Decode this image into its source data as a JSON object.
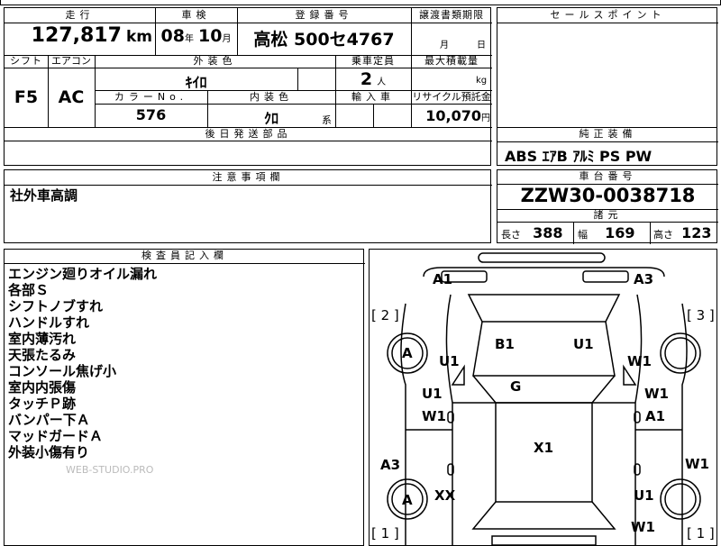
{
  "mileage": {
    "header": "走行",
    "value": "127,817",
    "unit": "km"
  },
  "inspection": {
    "header": "車検",
    "year": "08",
    "year_unit": "年",
    "month": "10",
    "month_unit": "月"
  },
  "registration": {
    "header": "登録番号",
    "value": "高松 500セ4767"
  },
  "transfer": {
    "header": "譲渡書類期限",
    "month_unit": "月",
    "day_unit": "日"
  },
  "sales_point": {
    "header": "セールスポイント"
  },
  "shift": {
    "header": "シフト",
    "value": "F5"
  },
  "aircon": {
    "header": "エアコン",
    "value": "AC"
  },
  "exterior_color": {
    "header": "外装色",
    "value": "ｷｲﾛ"
  },
  "capacity": {
    "header": "乗車定員",
    "value": "2",
    "unit": "人"
  },
  "max_load": {
    "header": "最大積載量",
    "unit": "kg"
  },
  "color_no": {
    "header": "カラーNo.",
    "value": "576"
  },
  "interior_color": {
    "header": "内装色",
    "value": "ｸﾛ",
    "suffix": "系"
  },
  "import": {
    "header": "輸入車"
  },
  "recycle": {
    "header": "リサイクル預託金",
    "value": "10,070",
    "unit": "円"
  },
  "later_parts": {
    "header": "後日発送部品"
  },
  "equipment": {
    "header": "純正装備",
    "value": "ABS ｴｱB ｱﾙﾐ PS PW"
  },
  "notes": {
    "header": "注意事項欄",
    "value": "社外車高調"
  },
  "chassis": {
    "header": "車台番号",
    "value": "ZZW30-0038718"
  },
  "specs": {
    "header": "諸元",
    "length_label": "長さ",
    "length": "388",
    "width_label": "幅",
    "width": "169",
    "height_label": "高さ",
    "height": "123"
  },
  "inspector": {
    "header": "検査員記入欄",
    "lines": [
      "エンジン廻りオイル漏れ",
      "各部Ｓ",
      "シフトノブすれ",
      "ハンドルすれ",
      "室内薄汚れ",
      "天張たるみ",
      "コンソール焦げ小",
      "室内内張傷",
      "タッチＰ跡",
      "バンパー下Ａ",
      "マッドガードＡ",
      "外装小傷有り"
    ]
  },
  "watermark": "WEB-STUDIO.PRO",
  "diagram": {
    "marks": [
      "A1",
      "A3",
      "[ 2 ]",
      "[ 3 ]",
      "A",
      "U1",
      "B1",
      "U1",
      "W1",
      "U1",
      "G",
      "W1",
      "W1",
      "A1",
      "X1",
      "A3",
      "W1",
      "A",
      "XX",
      "U1",
      "W1",
      "[ 1 ]",
      "[ 1 ]"
    ]
  }
}
